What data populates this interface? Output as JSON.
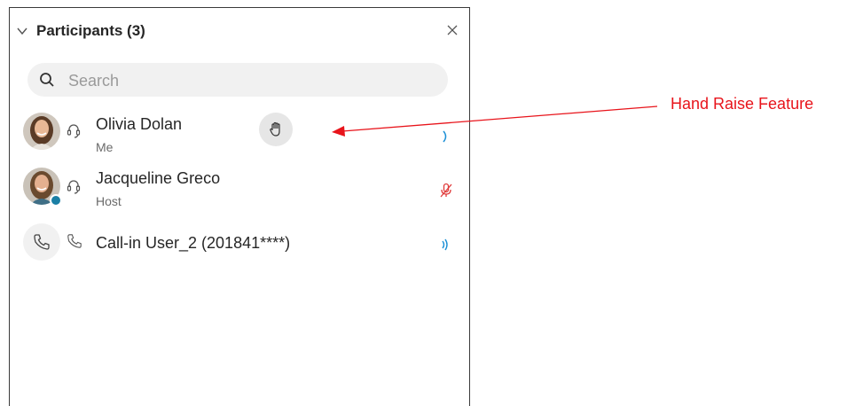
{
  "panel": {
    "title": "Participants (3)",
    "search_placeholder": "Search"
  },
  "participants": [
    {
      "name": "Olivia Dolan",
      "role": "Me",
      "audio": "speaking-icon"
    },
    {
      "name": "Jacqueline Greco",
      "role": "Host",
      "audio": "muted-mic-icon"
    },
    {
      "name": "Call-in User_2 (201841****)",
      "role": "",
      "audio": "speaking-icon"
    }
  ],
  "annotation": {
    "label": "Hand Raise Feature"
  },
  "colors": {
    "annotation": "#e8141b",
    "speaking": "#1a8fd6",
    "muted": "#e03b3b",
    "status": "#1a7fa5"
  }
}
